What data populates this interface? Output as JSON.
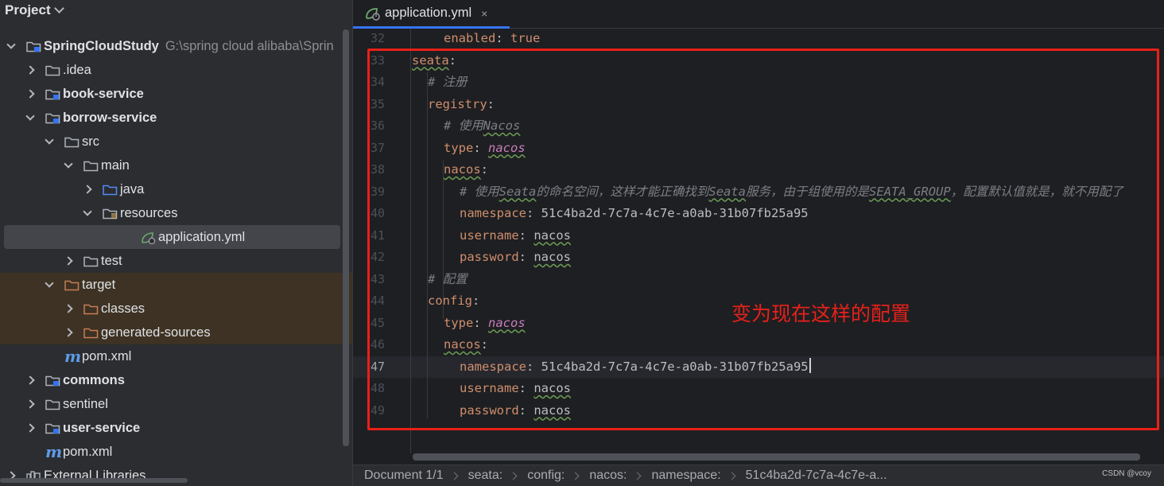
{
  "project": {
    "title": "Project",
    "tree": [
      {
        "label": "SpringCloudStudy",
        "path": "G:\\spring cloud alibaba\\Sprin",
        "depth": 0,
        "arrow": "open",
        "icon": "module-folder",
        "bold": true
      },
      {
        "label": ".idea",
        "depth": 1,
        "arrow": "closed",
        "icon": "folder"
      },
      {
        "label": "book-service",
        "depth": 1,
        "arrow": "closed",
        "icon": "module-folder",
        "bold": true
      },
      {
        "label": "borrow-service",
        "depth": 1,
        "arrow": "open",
        "icon": "module-folder",
        "bold": true
      },
      {
        "label": "src",
        "depth": 2,
        "arrow": "open",
        "icon": "folder"
      },
      {
        "label": "main",
        "depth": 3,
        "arrow": "open",
        "icon": "folder"
      },
      {
        "label": "java",
        "depth": 4,
        "arrow": "closed",
        "icon": "source-folder"
      },
      {
        "label": "resources",
        "depth": 4,
        "arrow": "open",
        "icon": "resources-folder"
      },
      {
        "label": "application.yml",
        "depth": 6,
        "arrow": "none",
        "icon": "spring-yml",
        "selected": true
      },
      {
        "label": "test",
        "depth": 3,
        "arrow": "closed",
        "icon": "folder"
      },
      {
        "label": "target",
        "depth": 2,
        "arrow": "open",
        "icon": "excluded-folder",
        "excluded": true
      },
      {
        "label": "classes",
        "depth": 3,
        "arrow": "closed",
        "icon": "excluded-folder",
        "excluded": true
      },
      {
        "label": "generated-sources",
        "depth": 3,
        "arrow": "closed",
        "icon": "excluded-folder",
        "excluded": true
      },
      {
        "label": "pom.xml",
        "depth": 2,
        "arrow": "none",
        "icon": "maven-m"
      },
      {
        "label": "commons",
        "depth": 1,
        "arrow": "closed",
        "icon": "module-folder",
        "bold": true
      },
      {
        "label": "sentinel",
        "depth": 1,
        "arrow": "closed",
        "icon": "folder"
      },
      {
        "label": "user-service",
        "depth": 1,
        "arrow": "closed",
        "icon": "module-folder",
        "bold": true
      },
      {
        "label": "pom.xml",
        "depth": 1,
        "arrow": "none",
        "icon": "maven-m"
      },
      {
        "label": "External Libraries",
        "depth": 0,
        "arrow": "closed",
        "icon": "libraries"
      }
    ]
  },
  "editor": {
    "tab": {
      "label": "application.yml",
      "close": "×",
      "icon": "spring-yml-icon"
    },
    "current_line": 47,
    "lines": [
      {
        "n": "32",
        "indent": 2,
        "parts": [
          {
            "t": "enabled",
            "c": "k"
          },
          {
            "t": ": ",
            "c": "v"
          },
          {
            "t": "true",
            "c": "k"
          }
        ]
      },
      {
        "n": "33",
        "indent": 0,
        "parts": [
          {
            "t": "seata",
            "c": "k uw"
          },
          {
            "t": ":",
            "c": "v"
          }
        ]
      },
      {
        "n": "34",
        "indent": 1,
        "parts": [
          {
            "t": "# 注册",
            "c": "c"
          }
        ]
      },
      {
        "n": "35",
        "indent": 1,
        "parts": [
          {
            "t": "registry",
            "c": "k"
          },
          {
            "t": ":",
            "c": "v"
          }
        ]
      },
      {
        "n": "36",
        "indent": 2,
        "parts": [
          {
            "t": "# 使用",
            "c": "c"
          },
          {
            "t": "Nacos",
            "c": "c uw"
          }
        ]
      },
      {
        "n": "37",
        "indent": 2,
        "parts": [
          {
            "t": "type",
            "c": "k"
          },
          {
            "t": ": ",
            "c": "v"
          },
          {
            "t": "nacos",
            "c": "ital uw"
          }
        ]
      },
      {
        "n": "38",
        "indent": 2,
        "parts": [
          {
            "t": "nacos",
            "c": "k uw"
          },
          {
            "t": ":",
            "c": "v"
          }
        ]
      },
      {
        "n": "39",
        "indent": 3,
        "parts": [
          {
            "t": "# 使用",
            "c": "c"
          },
          {
            "t": "Seata",
            "c": "c uw"
          },
          {
            "t": "的命名空间，这样才能正确找到",
            "c": "c"
          },
          {
            "t": "Seata",
            "c": "c uw"
          },
          {
            "t": "服务，由于组使用的是",
            "c": "c"
          },
          {
            "t": "SEATA_GROUP",
            "c": "c uw"
          },
          {
            "t": "，配置默认值就是，就不用配了",
            "c": "c"
          }
        ]
      },
      {
        "n": "40",
        "indent": 3,
        "parts": [
          {
            "t": "namespace",
            "c": "k"
          },
          {
            "t": ": 51c4ba2d-7c7a-4c7e-a0ab-31b07fb25a95",
            "c": "v"
          }
        ]
      },
      {
        "n": "41",
        "indent": 3,
        "parts": [
          {
            "t": "username",
            "c": "k"
          },
          {
            "t": ": ",
            "c": "v"
          },
          {
            "t": "nacos",
            "c": "v uw"
          }
        ]
      },
      {
        "n": "42",
        "indent": 3,
        "parts": [
          {
            "t": "password",
            "c": "k"
          },
          {
            "t": ": ",
            "c": "v"
          },
          {
            "t": "nacos",
            "c": "v uw"
          }
        ]
      },
      {
        "n": "43",
        "indent": 1,
        "parts": [
          {
            "t": "# 配置",
            "c": "c"
          }
        ]
      },
      {
        "n": "44",
        "indent": 1,
        "parts": [
          {
            "t": "config",
            "c": "k"
          },
          {
            "t": ":",
            "c": "v"
          }
        ]
      },
      {
        "n": "45",
        "indent": 2,
        "parts": [
          {
            "t": "type",
            "c": "k"
          },
          {
            "t": ": ",
            "c": "v"
          },
          {
            "t": "nacos",
            "c": "ital uw"
          }
        ]
      },
      {
        "n": "46",
        "indent": 2,
        "parts": [
          {
            "t": "nacos",
            "c": "k uw"
          },
          {
            "t": ":",
            "c": "v"
          }
        ]
      },
      {
        "n": "47",
        "indent": 3,
        "parts": [
          {
            "t": "namespace",
            "c": "k"
          },
          {
            "t": ": 51c4ba2d-7c7a-4c7e-a0ab-31b07fb25a95",
            "c": "v"
          }
        ],
        "caret": true
      },
      {
        "n": "48",
        "indent": 3,
        "parts": [
          {
            "t": "username",
            "c": "k"
          },
          {
            "t": ": ",
            "c": "v"
          },
          {
            "t": "nacos",
            "c": "v uw"
          }
        ]
      },
      {
        "n": "49",
        "indent": 3,
        "parts": [
          {
            "t": "password",
            "c": "k"
          },
          {
            "t": ": ",
            "c": "v"
          },
          {
            "t": "nacos",
            "c": "v uw"
          }
        ]
      }
    ],
    "annotation": "变为现在这样的配置"
  },
  "statusbar": {
    "items": [
      "Document 1/1",
      "seata:",
      "config:",
      "nacos:",
      "namespace:",
      "51c4ba2d-7c7a-4c7e-a..."
    ]
  },
  "watermark": "CSDN @vcoy",
  "colors": {
    "accent": "#3574f0",
    "annotation_red": "#e8201a",
    "excluded_bg": "#3d3223"
  }
}
